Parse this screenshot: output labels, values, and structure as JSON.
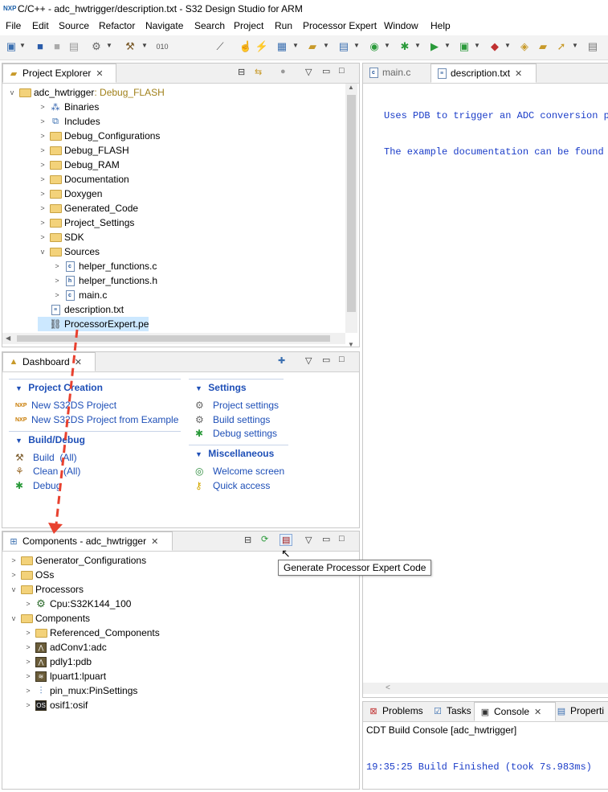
{
  "window": {
    "title": "C/C++ - adc_hwtrigger/description.txt - S32 Design Studio for ARM",
    "app_logo_text": "NXP"
  },
  "menu": [
    "File",
    "Edit",
    "Source",
    "Refactor",
    "Navigate",
    "Search",
    "Project",
    "Run",
    "Processor Expert",
    "Window",
    "Help"
  ],
  "project_explorer": {
    "tab_label": "Project Explorer",
    "project_name": "adc_hwtrigger",
    "project_config": "Debug_FLASH",
    "items": [
      {
        "label": "Binaries",
        "kind": "binaries",
        "level": 1,
        "expand": ">"
      },
      {
        "label": "Includes",
        "kind": "includes",
        "level": 1,
        "expand": ">"
      },
      {
        "label": "Debug_Configurations",
        "kind": "folder",
        "level": 1,
        "expand": ">"
      },
      {
        "label": "Debug_FLASH",
        "kind": "folder",
        "level": 1,
        "expand": ">"
      },
      {
        "label": "Debug_RAM",
        "kind": "folder",
        "level": 1,
        "expand": ">"
      },
      {
        "label": "Documentation",
        "kind": "folder",
        "level": 1,
        "expand": ">"
      },
      {
        "label": "Doxygen",
        "kind": "folder",
        "level": 1,
        "expand": ">"
      },
      {
        "label": "Generated_Code",
        "kind": "folder",
        "level": 1,
        "expand": ">"
      },
      {
        "label": "Project_Settings",
        "kind": "folder",
        "level": 1,
        "expand": ">"
      },
      {
        "label": "SDK",
        "kind": "folder",
        "level": 1,
        "expand": ">"
      },
      {
        "label": "Sources",
        "kind": "folder",
        "level": 1,
        "expand": "v"
      },
      {
        "label": "helper_functions.c",
        "kind": "cfile",
        "level": 2,
        "expand": ">"
      },
      {
        "label": "helper_functions.h",
        "kind": "hfile",
        "level": 2,
        "expand": ">"
      },
      {
        "label": "main.c",
        "kind": "cfile",
        "level": 2,
        "expand": ">"
      },
      {
        "label": "description.txt",
        "kind": "txt",
        "level": 1,
        "expand": ""
      },
      {
        "label": "ProcessorExpert.pe",
        "kind": "pe",
        "level": 1,
        "expand": "",
        "selected": true
      }
    ]
  },
  "editor": {
    "tabs": [
      {
        "label": "main.c",
        "active": false
      },
      {
        "label": "description.txt",
        "active": true
      }
    ],
    "lines": [
      "Uses PDB to trigger an ADC conversion p",
      "The example documentation can be found"
    ]
  },
  "dashboard": {
    "tab_label": "Dashboard",
    "project_creation": {
      "title": "Project Creation",
      "items": [
        "New S32DS Project",
        "New S32DS Project from Example"
      ]
    },
    "build_debug": {
      "title": "Build/Debug",
      "items": [
        "Build  (All)",
        "Clean  (All)",
        "Debug"
      ]
    },
    "settings": {
      "title": "Settings",
      "items": [
        "Project settings",
        "Build settings",
        "Debug settings"
      ]
    },
    "misc": {
      "title": "Miscellaneous",
      "items": [
        "Welcome screen",
        "Quick access"
      ]
    }
  },
  "components": {
    "tab_label": "Components - adc_hwtrigger",
    "tooltip": "Generate Processor Expert Code",
    "items": [
      {
        "label": "Generator_Configurations",
        "kind": "folder",
        "level": 0,
        "expand": ">"
      },
      {
        "label": "OSs",
        "kind": "folder",
        "level": 0,
        "expand": ">"
      },
      {
        "label": "Processors",
        "kind": "folder",
        "level": 0,
        "expand": "v"
      },
      {
        "label": "Cpu:S32K144_100",
        "kind": "cpu",
        "level": 1,
        "expand": ">"
      },
      {
        "label": "Components",
        "kind": "folder",
        "level": 0,
        "expand": "v"
      },
      {
        "label": "Referenced_Components",
        "kind": "folder",
        "level": 1,
        "expand": ">"
      },
      {
        "label": "adConv1:adc",
        "kind": "adc",
        "level": 1,
        "expand": ">"
      },
      {
        "label": "pdly1:pdb",
        "kind": "pdb",
        "level": 1,
        "expand": ">"
      },
      {
        "label": "lpuart1:lpuart",
        "kind": "uart",
        "level": 1,
        "expand": ">"
      },
      {
        "label": "pin_mux:PinSettings",
        "kind": "pins",
        "level": 1,
        "expand": ">"
      },
      {
        "label": "osif1:osif",
        "kind": "osif",
        "level": 1,
        "expand": ">"
      }
    ]
  },
  "bottom_panel": {
    "tabs": [
      {
        "label": "Problems",
        "active": false
      },
      {
        "label": "Tasks",
        "active": false
      },
      {
        "label": "Console",
        "active": true
      },
      {
        "label": "Properti",
        "active": false
      }
    ],
    "console_title": "CDT Build Console [adc_hwtrigger]",
    "console_line": "19:35:25 Build Finished (took 7s.983ms)"
  },
  "colors": {
    "link": "#1e4fb7",
    "selection": "#cce8ff",
    "annotation": "#e8412f",
    "console_text": "#1a3cc8"
  }
}
